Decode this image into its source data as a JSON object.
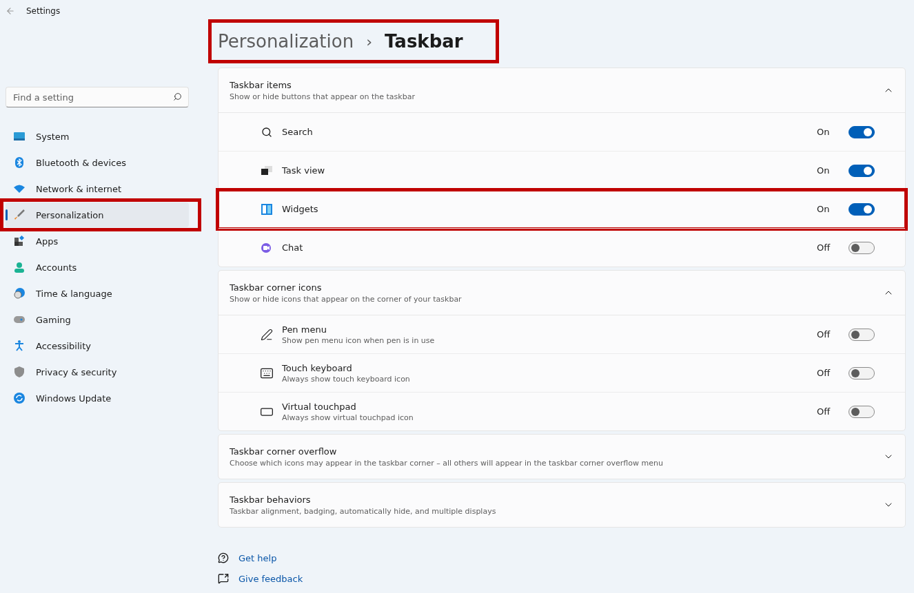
{
  "window": {
    "title": "Settings"
  },
  "search": {
    "placeholder": "Find a setting"
  },
  "sidebar": {
    "items": [
      {
        "label": "System",
        "selected": false,
        "highlighted": false
      },
      {
        "label": "Bluetooth & devices",
        "selected": false,
        "highlighted": false
      },
      {
        "label": "Network & internet",
        "selected": false,
        "highlighted": false
      },
      {
        "label": "Personalization",
        "selected": true,
        "highlighted": true
      },
      {
        "label": "Apps",
        "selected": false,
        "highlighted": false
      },
      {
        "label": "Accounts",
        "selected": false,
        "highlighted": false
      },
      {
        "label": "Time & language",
        "selected": false,
        "highlighted": false
      },
      {
        "label": "Gaming",
        "selected": false,
        "highlighted": false
      },
      {
        "label": "Accessibility",
        "selected": false,
        "highlighted": false
      },
      {
        "label": "Privacy & security",
        "selected": false,
        "highlighted": false
      },
      {
        "label": "Windows Update",
        "selected": false,
        "highlighted": false
      }
    ]
  },
  "breadcrumb": {
    "parent": "Personalization",
    "separator": "›",
    "current": "Taskbar",
    "highlighted": true
  },
  "sections": [
    {
      "title": "Taskbar items",
      "subtitle": "Show or hide buttons that appear on the taskbar",
      "expanded": true,
      "rows": [
        {
          "label": "Search",
          "state": "On",
          "on": true,
          "highlighted": false
        },
        {
          "label": "Task view",
          "state": "On",
          "on": true,
          "highlighted": false
        },
        {
          "label": "Widgets",
          "state": "On",
          "on": true,
          "highlighted": true
        },
        {
          "label": "Chat",
          "state": "Off",
          "on": false,
          "highlighted": false
        }
      ]
    },
    {
      "title": "Taskbar corner icons",
      "subtitle": "Show or hide icons that appear on the corner of your taskbar",
      "expanded": true,
      "rows": [
        {
          "label": "Pen menu",
          "description": "Show pen menu icon when pen is in use",
          "state": "Off",
          "on": false,
          "highlighted": false
        },
        {
          "label": "Touch keyboard",
          "description": "Always show touch keyboard icon",
          "state": "Off",
          "on": false,
          "highlighted": false
        },
        {
          "label": "Virtual touchpad",
          "description": "Always show virtual touchpad icon",
          "state": "Off",
          "on": false,
          "highlighted": false
        }
      ]
    },
    {
      "title": "Taskbar corner overflow",
      "subtitle": "Choose which icons may appear in the taskbar corner – all others will appear in the taskbar corner overflow menu",
      "expanded": false
    },
    {
      "title": "Taskbar behaviors",
      "subtitle": "Taskbar alignment, badging, automatically hide, and multiple displays",
      "expanded": false
    }
  ],
  "links": [
    "Get help",
    "Give feedback"
  ]
}
